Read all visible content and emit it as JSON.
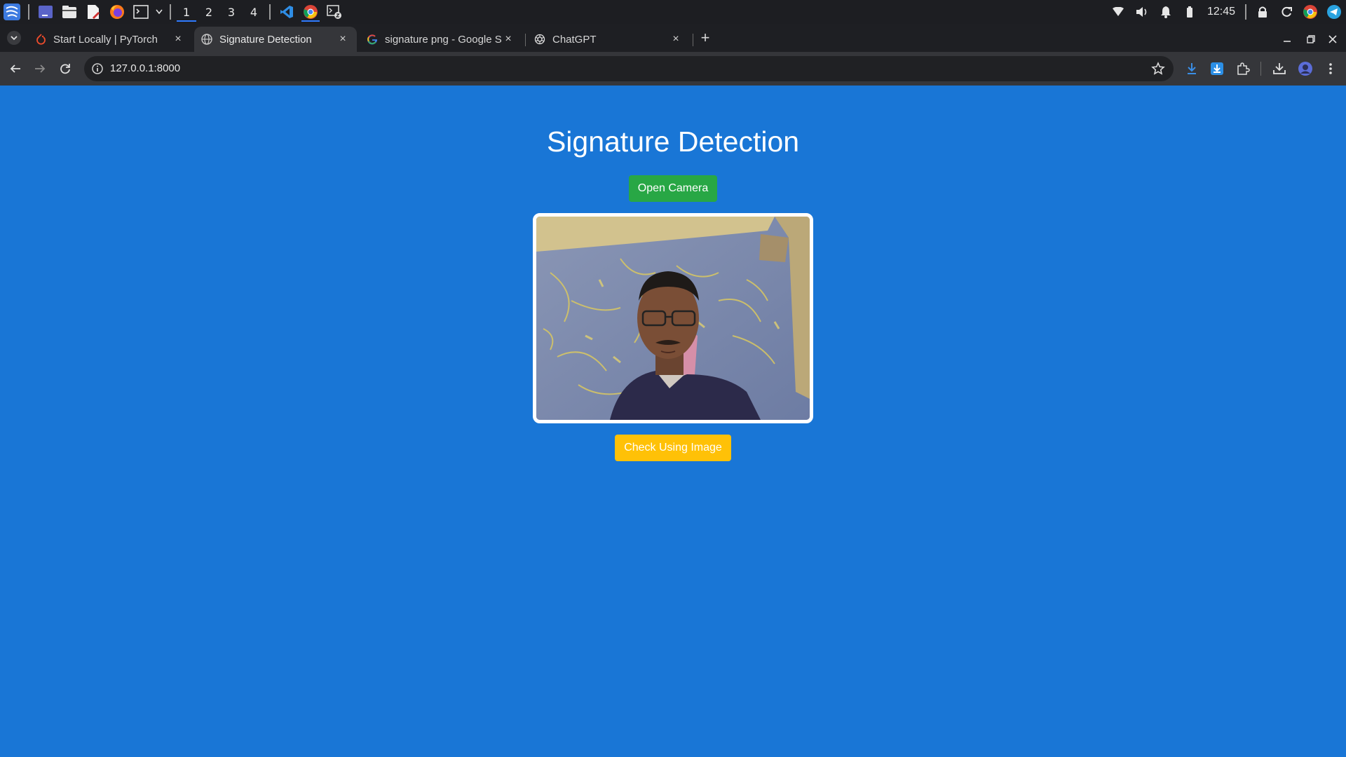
{
  "taskbar": {
    "workspaces": [
      "1",
      "2",
      "3",
      "4"
    ],
    "active_workspace": "1",
    "clock": "12:45"
  },
  "browser": {
    "tabs": [
      {
        "label": "Start Locally | PyTorch",
        "icon": "pytorch-icon"
      },
      {
        "label": "Signature Detection",
        "icon": "globe-icon"
      },
      {
        "label": "signature png - Google S",
        "icon": "google-icon"
      },
      {
        "label": "ChatGPT",
        "icon": "chatgpt-icon"
      }
    ],
    "active_tab": 1,
    "new_tab_label": "+",
    "url": "127.0.0.1:8000"
  },
  "page": {
    "title": "Signature Detection",
    "open_camera_label": "Open Camera",
    "check_image_label": "Check Using Image"
  },
  "colors": {
    "page_background": "#1976d6",
    "open_camera_button": "#28a745",
    "check_image_button": "#ffc107",
    "tab_active": "#35363a"
  }
}
